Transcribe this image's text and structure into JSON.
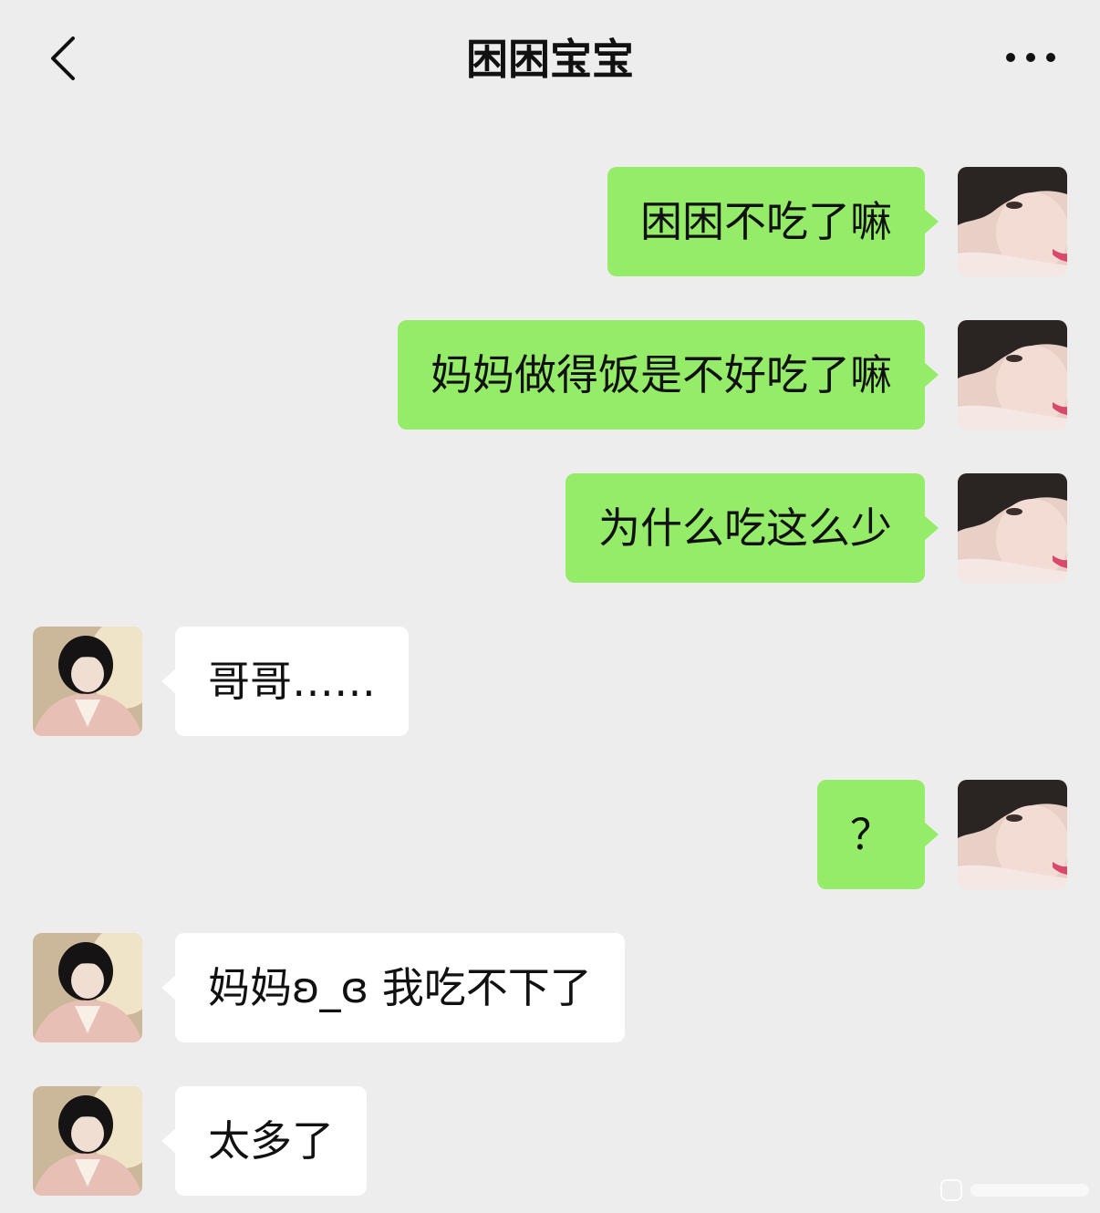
{
  "header": {
    "title": "困困宝宝",
    "back_icon": "chevron-left-icon",
    "more_icon": "ellipsis-icon"
  },
  "colors": {
    "background": "#ededed",
    "self_bubble": "#95ec69",
    "other_bubble": "#ffffff"
  },
  "messages": [
    {
      "side": "right",
      "text": "困困不吃了嘛"
    },
    {
      "side": "right",
      "text": "妈妈做得饭是不好吃了嘛"
    },
    {
      "side": "right",
      "text": "为什么吃这么少"
    },
    {
      "side": "left",
      "text": "哥哥……"
    },
    {
      "side": "right",
      "text": "？"
    },
    {
      "side": "left",
      "text": "妈妈ʚ_ɞ 我吃不下了"
    },
    {
      "side": "left",
      "text": "太多了"
    }
  ]
}
